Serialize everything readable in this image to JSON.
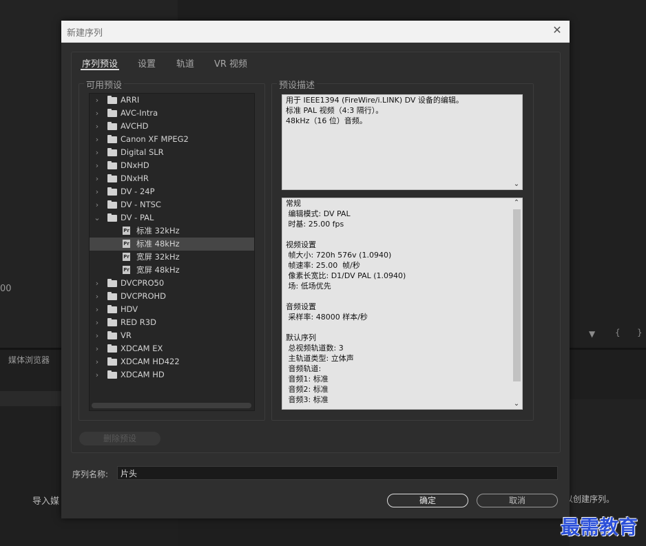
{
  "background": {
    "panel_value": "00",
    "media_browser_tab": "媒体浏览器",
    "import_text": "导入媒",
    "create_sequence_text": "以创建序列。",
    "marker_icon": "marker-icon",
    "in_point_icon": "in-point-icon",
    "out_point_icon": "out-point-icon"
  },
  "dialog": {
    "title": "新建序列",
    "close_icon": "close-icon",
    "tabs": [
      {
        "label": "序列预设"
      },
      {
        "label": "设置"
      },
      {
        "label": "轨道"
      },
      {
        "label": "VR 视频"
      }
    ],
    "available_presets_label": "可用预设",
    "preset_description_label": "预设描述",
    "presets": [
      {
        "label": "ARRI",
        "type": "folder",
        "expanded": false
      },
      {
        "label": "AVC-Intra",
        "type": "folder",
        "expanded": false
      },
      {
        "label": "AVCHD",
        "type": "folder",
        "expanded": false
      },
      {
        "label": "Canon XF MPEG2",
        "type": "folder",
        "expanded": false
      },
      {
        "label": "Digital SLR",
        "type": "folder",
        "expanded": false
      },
      {
        "label": "DNxHD",
        "type": "folder",
        "expanded": false
      },
      {
        "label": "DNxHR",
        "type": "folder",
        "expanded": false
      },
      {
        "label": "DV - 24P",
        "type": "folder",
        "expanded": false
      },
      {
        "label": "DV - NTSC",
        "type": "folder",
        "expanded": false
      },
      {
        "label": "DV - PAL",
        "type": "folder",
        "expanded": true
      },
      {
        "label": "标准 32kHz",
        "type": "preset",
        "selected": false
      },
      {
        "label": "标准 48kHz",
        "type": "preset",
        "selected": true
      },
      {
        "label": "宽屏 32kHz",
        "type": "preset",
        "selected": false
      },
      {
        "label": "宽屏 48kHz",
        "type": "preset",
        "selected": false
      },
      {
        "label": "DVCPRO50",
        "type": "folder",
        "expanded": false
      },
      {
        "label": "DVCPROHD",
        "type": "folder",
        "expanded": false
      },
      {
        "label": "HDV",
        "type": "folder",
        "expanded": false
      },
      {
        "label": "RED R3D",
        "type": "folder",
        "expanded": false
      },
      {
        "label": "VR",
        "type": "folder",
        "expanded": false
      },
      {
        "label": "XDCAM EX",
        "type": "folder",
        "expanded": false
      },
      {
        "label": "XDCAM HD422",
        "type": "folder",
        "expanded": false
      },
      {
        "label": "XDCAM HD",
        "type": "folder",
        "expanded": false
      }
    ],
    "description_lines": [
      "用于 IEEE1394 (FireWire/i.LINK) DV 设备的编辑。",
      "标准 PAL 视频（4:3 隔行）。",
      "48kHz（16 位）音频。"
    ],
    "details_lines": [
      "常规",
      " 编辑模式: DV PAL",
      " 时基: 25.00 fps",
      "",
      "视频设置",
      " 帧大小: 720h 576v (1.0940)",
      " 帧速率: 25.00  帧/秒",
      " 像素长宽比: D1/DV PAL (1.0940)",
      " 场: 低场优先",
      "",
      "音频设置",
      " 采样率: 48000 样本/秒",
      "",
      "默认序列",
      " 总视频轨道数: 3",
      " 主轨道类型: 立体声",
      " 音频轨道:",
      " 音频1: 标准",
      " 音频2: 标准",
      " 音频3: 标准"
    ],
    "delete_preset_label": "删除预设",
    "sequence_name_label": "序列名称:",
    "sequence_name_value": "片头",
    "ok_label": "确定",
    "cancel_label": "取消"
  },
  "watermark": "最需教育"
}
